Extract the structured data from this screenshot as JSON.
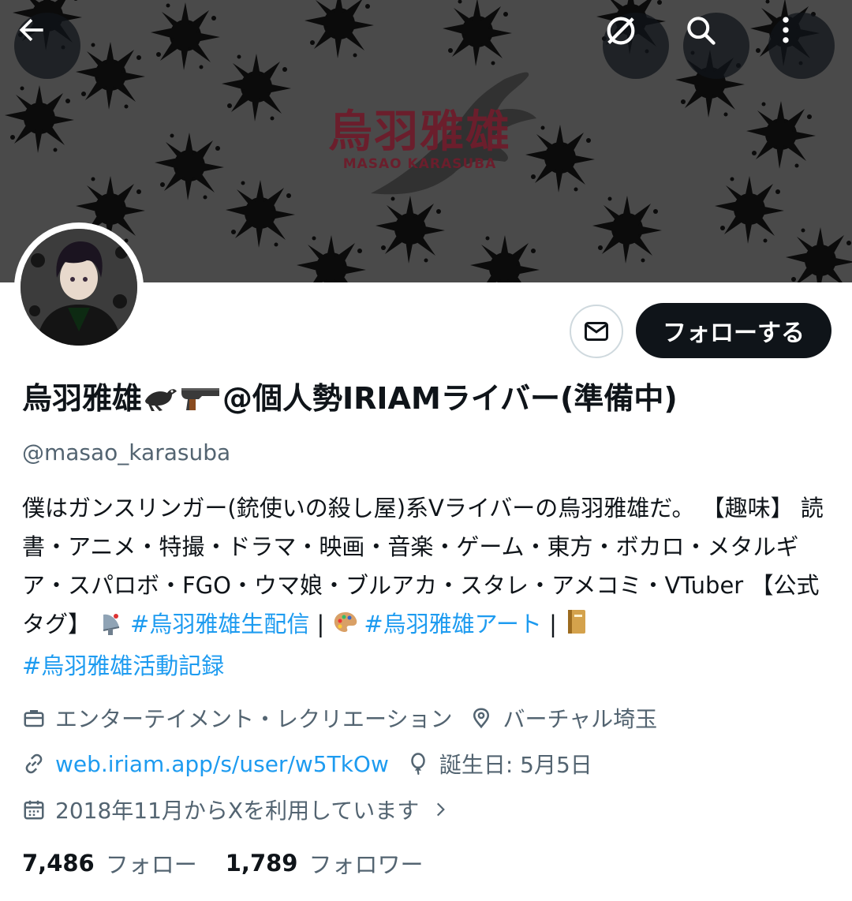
{
  "profile": {
    "banner_brand_jp": "烏羽雅雄",
    "banner_brand_en": "MASAO KARASUBA",
    "display_name_prefix": "烏羽雅雄",
    "display_name_suffix": "@個人勢IRIAMライバー(準備中)",
    "handle": "@masao_karasuba",
    "follow_label": "フォローする"
  },
  "bio": {
    "text": "僕はガンスリンガー(銃使いの殺し屋)系Vライバーの烏羽雅雄だ。 【趣味】 読書・アニメ・特撮・ドラマ・映画・音楽・ゲーム・東方・ボカロ・メタルギア・スパロボ・FGO・ウマ娘・ブルアカ・スタレ・アメコミ・VTuber 【公式タグ】",
    "tag1": "#烏羽雅雄生配信",
    "separator": "|",
    "tag2": "#烏羽雅雄アート",
    "tag3": "#烏羽雅雄活動記録"
  },
  "meta": {
    "category": "エンターテイメント・レクリエーション",
    "location": "バーチャル埼玉",
    "website": "web.iriam.app/s/user/w5TkOw",
    "birthday": "誕生日: 5月5日",
    "joined": "2018年11月からXを利用しています"
  },
  "stats": {
    "following_count": "7,486",
    "following_label": "フォロー",
    "followers_count": "1,789",
    "followers_label": "フォロワー"
  },
  "colors": {
    "accent": "#1d9bf0",
    "text": "#0f1419",
    "secondary": "#536471",
    "banner_bg": "#4a4a4a",
    "brand_red": "#6b1e2c"
  },
  "icons": [
    "back-arrow-icon",
    "no-grok-icon",
    "search-icon",
    "more-icon",
    "mail-icon",
    "briefcase-icon",
    "location-pin-icon",
    "link-icon",
    "balloon-icon",
    "calendar-icon",
    "chevron-right-icon",
    "bird-emoji",
    "pistol-emoji",
    "satellite-emoji",
    "palette-emoji",
    "notebook-emoji"
  ]
}
